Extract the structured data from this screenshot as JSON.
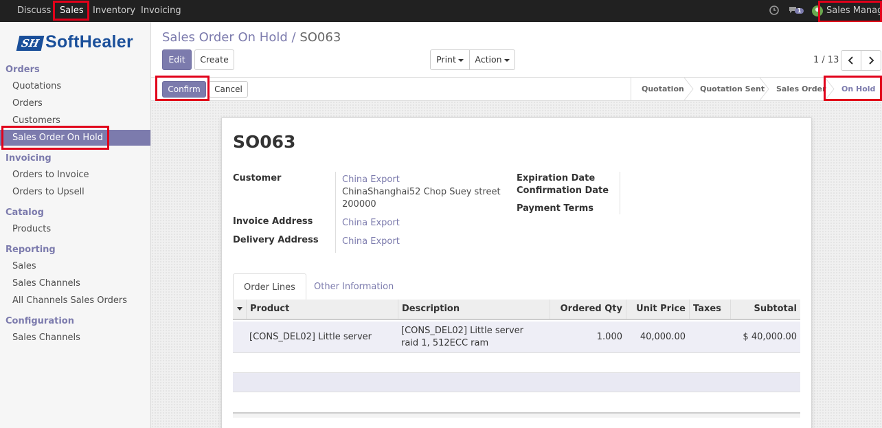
{
  "topbar": {
    "menus": [
      "Discuss",
      "Sales",
      "Inventory",
      "Invoicing"
    ],
    "active_menu": "Sales",
    "chat_badge": "1",
    "user": "Sales Manager"
  },
  "sidebar": {
    "logo_mark": "SH",
    "logo_text": "SoftHealer",
    "sections": [
      {
        "title": "Orders",
        "items": [
          "Quotations",
          "Orders",
          "Customers",
          "Sales Order On Hold"
        ]
      },
      {
        "title": "Invoicing",
        "items": [
          "Orders to Invoice",
          "Orders to Upsell"
        ]
      },
      {
        "title": "Catalog",
        "items": [
          "Products"
        ]
      },
      {
        "title": "Reporting",
        "items": [
          "Sales",
          "Sales Channels",
          "All Channels Sales Orders"
        ]
      },
      {
        "title": "Configuration",
        "items": [
          "Sales Channels"
        ]
      }
    ],
    "active_item": "Sales Order On Hold"
  },
  "control_panel": {
    "breadcrumb_parent": "Sales Order On Hold",
    "breadcrumb_sep": "/",
    "breadcrumb_current": "SO063",
    "edit_label": "Edit",
    "create_label": "Create",
    "print_label": "Print",
    "action_label": "Action",
    "pager": "1 / 13"
  },
  "statusbar": {
    "confirm_label": "Confirm",
    "cancel_label": "Cancel",
    "stages": [
      "Quotation",
      "Quotation Sent",
      "Sales Order",
      "On Hold"
    ],
    "current_stage": "On Hold"
  },
  "form": {
    "name": "SO063",
    "customer_label": "Customer",
    "customer_name": "China Export",
    "customer_address_1": "ChinaShanghai52 Chop Suey street",
    "customer_address_2": "200000",
    "invoice_address_label": "Invoice Address",
    "invoice_address": "China Export",
    "delivery_address_label": "Delivery Address",
    "delivery_address": "China Export",
    "expiration_label": "Expiration Date",
    "confirmation_label": "Confirmation Date",
    "payment_terms_label": "Payment Terms",
    "tabs": [
      "Order Lines",
      "Other Information"
    ],
    "columns": [
      "Product",
      "Description",
      "Ordered Qty",
      "Unit Price",
      "Taxes",
      "Subtotal"
    ],
    "lines": [
      {
        "product": "[CONS_DEL02] Little server",
        "description_1": "[CONS_DEL02] Little server",
        "description_2": "raid 1, 512ECC ram",
        "qty": "1.000",
        "unit_price": "40,000.00",
        "taxes": "",
        "subtotal": "$ 40,000.00"
      }
    ]
  },
  "colors": {
    "accent": "#7c7bad",
    "highlight": "#e1001a",
    "navbar": "#212121"
  }
}
